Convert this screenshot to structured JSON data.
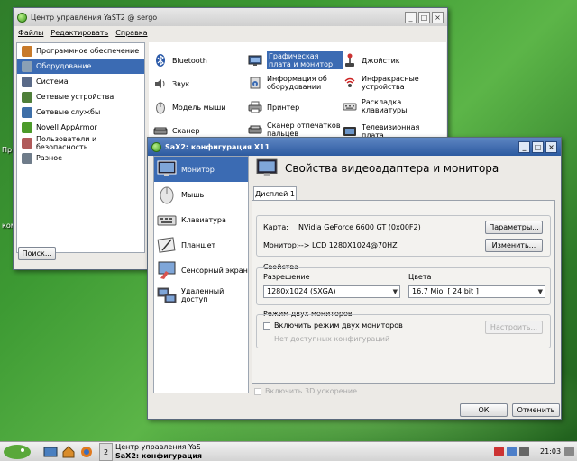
{
  "desktop": {
    "labels": [
      "Пр",
      "ком"
    ]
  },
  "yast": {
    "title": "Центр управления YaST2 @ sergo",
    "menu": [
      "Файлы",
      "Редактировать",
      "Справка"
    ],
    "categories": [
      {
        "label": "Программное обеспечение",
        "icon": "software-icon",
        "color": "#c87a2a"
      },
      {
        "label": "Оборудование",
        "icon": "hardware-icon",
        "color": "#8aa0b5",
        "selected": true
      },
      {
        "label": "Система",
        "icon": "system-icon",
        "color": "#5a6a88"
      },
      {
        "label": "Сетевые устройства",
        "icon": "network-devices-icon",
        "color": "#4f7f3a"
      },
      {
        "label": "Сетевые службы",
        "icon": "network-services-icon",
        "color": "#3e6fa8"
      },
      {
        "label": "Novell AppArmor",
        "icon": "apparmor-icon",
        "color": "#4c9a2a"
      },
      {
        "label": "Пользователи и безопасность",
        "icon": "users-icon",
        "color": "#b05a5a"
      },
      {
        "label": "Разное",
        "icon": "misc-icon",
        "color": "#6f7c8a"
      }
    ],
    "search_label": "Поиск...",
    "modules": [
      {
        "label": "Bluetooth",
        "icon": "bluetooth-icon"
      },
      {
        "label": "Графическая плата и монитор",
        "icon": "graphics-card-icon",
        "selected": true
      },
      {
        "label": "Джойстик",
        "icon": "joystick-icon"
      },
      {
        "label": "Звук",
        "icon": "sound-icon"
      },
      {
        "label": "Информация об оборудовании",
        "icon": "hardware-info-icon"
      },
      {
        "label": "Инфракрасные устройства",
        "icon": "infrared-icon"
      },
      {
        "label": "Модель мыши",
        "icon": "mouse-icon"
      },
      {
        "label": "Принтер",
        "icon": "printer-icon"
      },
      {
        "label": "Раскладка клавиатуры",
        "icon": "keyboard-layout-icon"
      },
      {
        "label": "Сканер",
        "icon": "scanner-icon"
      },
      {
        "label": "Сканер отпечатков пальцев",
        "icon": "fingerprint-icon"
      },
      {
        "label": "Телевизионная плата",
        "icon": "tv-card-icon"
      }
    ]
  },
  "sax": {
    "title": "SaX2: конфигурация X11",
    "nav": [
      {
        "label": "Монитор",
        "icon": "monitor-icon",
        "selected": true
      },
      {
        "label": "Мышь",
        "icon": "mouse-icon"
      },
      {
        "label": "Клавиатура",
        "icon": "keyboard-icon"
      },
      {
        "label": "Планшет",
        "icon": "tablet-icon"
      },
      {
        "label": "Сенсорный экран",
        "icon": "touchscreen-icon"
      },
      {
        "label": "Удаленный доступ",
        "icon": "remote-access-icon"
      }
    ],
    "heading": "Свойства видеоадаптера и монитора",
    "tab": "Дисплей 1",
    "card_label": "Карта:",
    "card_value": "NVidia GeForce 6600 GT (0x00F2)",
    "card_button": "Параметры...",
    "monitor_label": "Монитор:",
    "monitor_value": "--> LCD 1280X1024@70HZ",
    "monitor_button": "Изменить...",
    "properties_label": "Свойства",
    "resolution_label": "Разрешение",
    "resolution_value": "1280x1024 (SXGA)",
    "colors_label": "Цвета",
    "colors_value": "16.7 Mio. [ 24 bit ]",
    "dual_label": "Режим двух мониторов",
    "dual_checkbox": "Включить режим двух мониторов",
    "dual_configure": "Настроить...",
    "dual_none": "Нет доступных конфигураций",
    "enable_3d": "Включить 3D ускорение",
    "ok": "ОК",
    "cancel": "Отменить"
  },
  "taskbar": {
    "task1": "Центр управления YaST",
    "task2": "SaX2: конфигурация",
    "workspace": "2",
    "time": "21:03"
  }
}
